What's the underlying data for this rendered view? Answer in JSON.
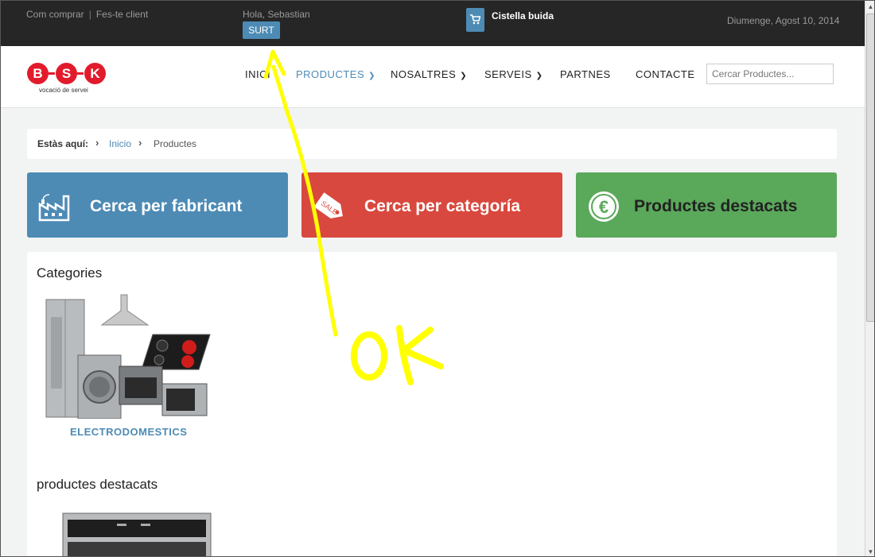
{
  "topbar": {
    "how_to_buy": "Com comprar",
    "separator": "|",
    "become_client": "Fes-te client",
    "greeting": "Hola, Sebastian",
    "logout": "SURT",
    "cart": "Cistella buida",
    "date": "Diumenge, Agost 10, 2014"
  },
  "logo": {
    "letters": [
      "B",
      "S",
      "K"
    ],
    "tagline": "vocació de servei",
    "color": "#e21b2c"
  },
  "nav": {
    "items": [
      {
        "label": "INICI",
        "dropdown": false
      },
      {
        "label": "PRODUCTES",
        "dropdown": true,
        "active": true
      },
      {
        "label": "NOSALTRES",
        "dropdown": true
      },
      {
        "label": "SERVEIS",
        "dropdown": true
      },
      {
        "label": "PARTNES",
        "dropdown": false
      },
      {
        "label": "CONTACTE",
        "dropdown": false
      }
    ],
    "search_placeholder": "Cercar Productes..."
  },
  "breadcrumb": {
    "label": "Estàs aquí:",
    "home": "Inicio",
    "current": "Productes"
  },
  "tiles": [
    {
      "title": "Cerca per fabricant",
      "icon": "factory-icon",
      "color": "#4d8bb5"
    },
    {
      "title": "Cerca per categoría",
      "icon": "sale-tag-icon",
      "color": "#d9483e"
    },
    {
      "title": "Productes destacats",
      "icon": "euro-icon",
      "color": "#5aa85a"
    }
  ],
  "main": {
    "categories_title": "Categories",
    "category_label": "ELECTRODOMESTICS",
    "featured_title": "productes destacats"
  },
  "annotation": {
    "text": "OK",
    "color": "#ffff00"
  },
  "colors": {
    "accent": "#4d8bb5",
    "topbar": "#262626"
  }
}
